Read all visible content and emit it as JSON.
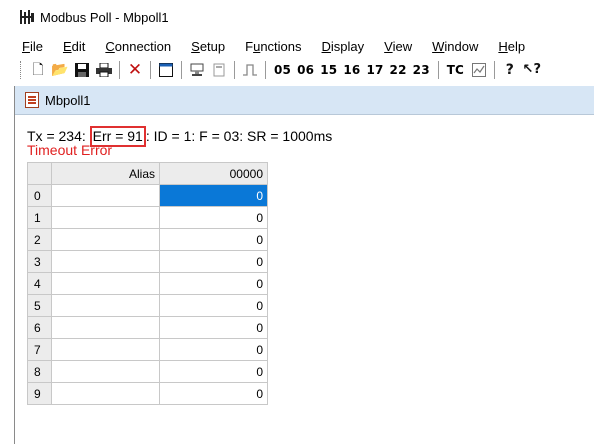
{
  "window": {
    "title": "Modbus Poll - Mbpoll1",
    "icon": "modbus-poll-app-icon"
  },
  "menubar": {
    "items": [
      {
        "label": "File",
        "accel": "F"
      },
      {
        "label": "Edit",
        "accel": "E"
      },
      {
        "label": "Connection",
        "accel": "C"
      },
      {
        "label": "Setup",
        "accel": "S"
      },
      {
        "label": "Functions",
        "accel": "u"
      },
      {
        "label": "Display",
        "accel": "D"
      },
      {
        "label": "View",
        "accel": "V"
      },
      {
        "label": "Window",
        "accel": "W"
      },
      {
        "label": "Help",
        "accel": "H"
      }
    ]
  },
  "toolbar": {
    "icons": [
      "new-icon",
      "open-icon",
      "save-icon",
      "print-icon",
      "delete-icon",
      "window-icon",
      "connect-icon",
      "disconnect-icon",
      "pulse-icon"
    ],
    "function_codes": [
      "05",
      "06",
      "15",
      "16",
      "17",
      "22",
      "23"
    ],
    "tc_label": "TC",
    "help_icons": [
      "monitor-icon",
      "help-icon",
      "context-help-icon"
    ]
  },
  "child_window": {
    "title": "Mbpoll1",
    "status_prefix": "Tx = 234: ",
    "err_text": "Err = 91",
    "status_suffix": ": ID = 1: F = 03: SR = 1000ms",
    "error_message": "Timeout Error",
    "columns": [
      "Alias",
      "00000"
    ],
    "rows": [
      {
        "index": "0",
        "alias": "",
        "value": "0"
      },
      {
        "index": "1",
        "alias": "",
        "value": "0"
      },
      {
        "index": "2",
        "alias": "",
        "value": "0"
      },
      {
        "index": "3",
        "alias": "",
        "value": "0"
      },
      {
        "index": "4",
        "alias": "",
        "value": "0"
      },
      {
        "index": "5",
        "alias": "",
        "value": "0"
      },
      {
        "index": "6",
        "alias": "",
        "value": "0"
      },
      {
        "index": "7",
        "alias": "",
        "value": "0"
      },
      {
        "index": "8",
        "alias": "",
        "value": "0"
      },
      {
        "index": "9",
        "alias": "",
        "value": "0"
      }
    ]
  },
  "colors": {
    "error_red": "#e02020",
    "highlight_box": "#e03030",
    "selection_blue": "#0a78d7",
    "child_titlebar": "#d7e6f5"
  }
}
